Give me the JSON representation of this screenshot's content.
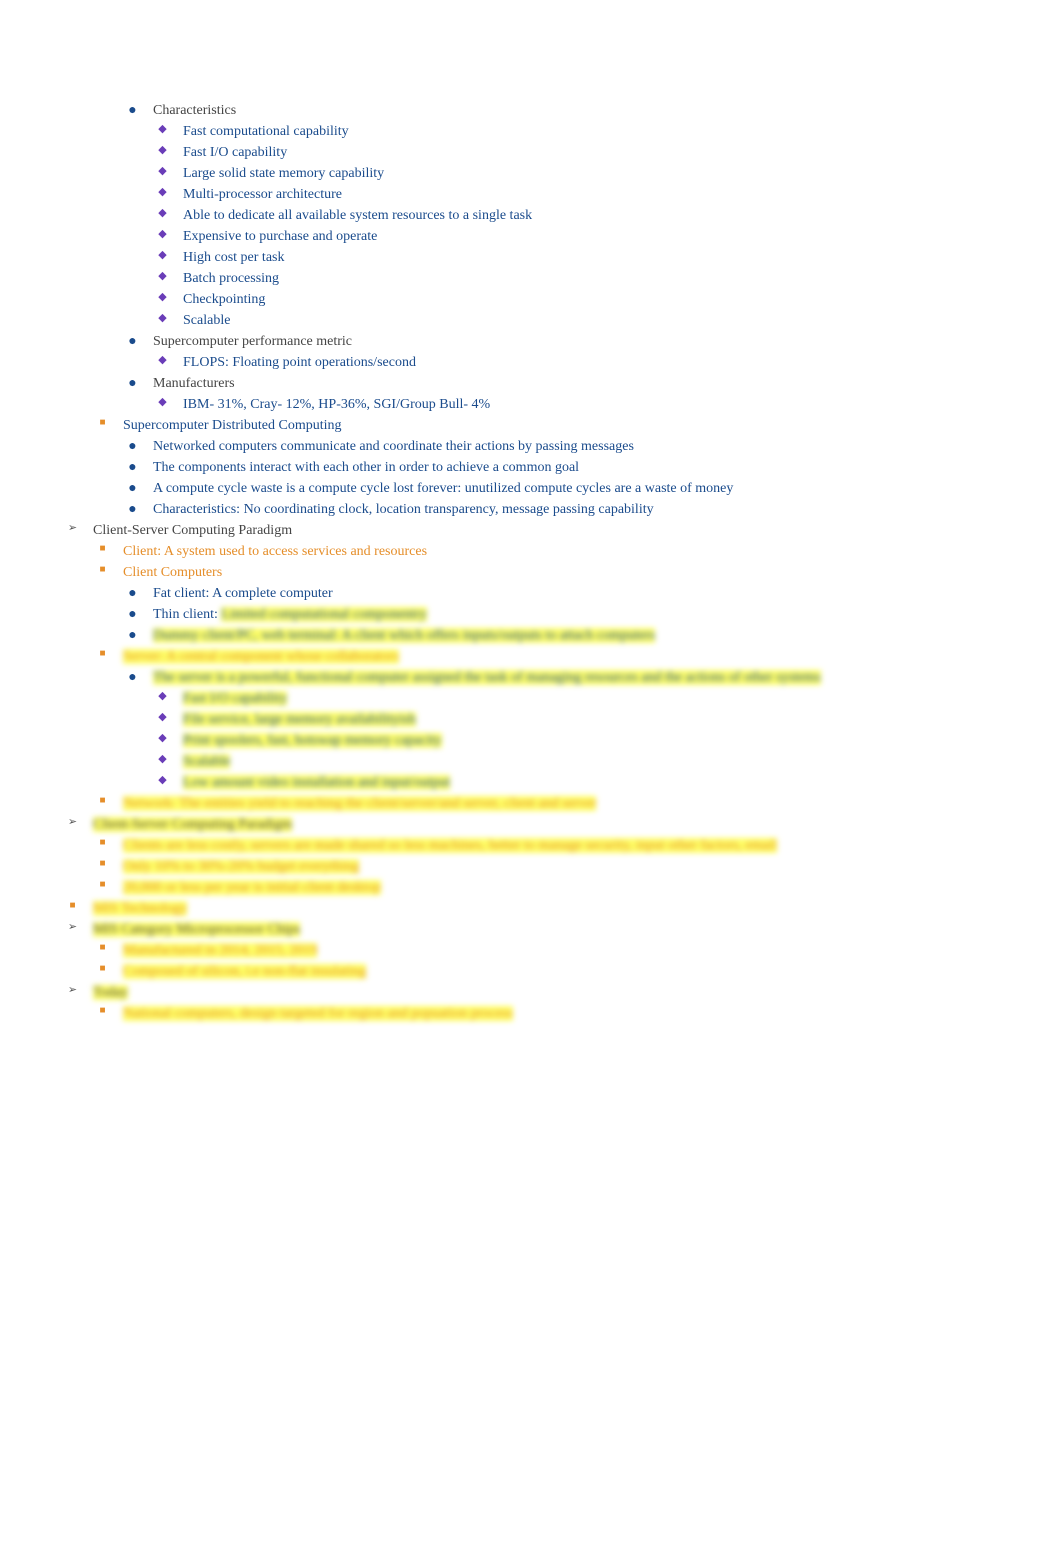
{
  "items": [
    {
      "level": "l2",
      "bstyle": "b-dot-blue",
      "bchar": "●",
      "tstyle": "c-dark",
      "text": "Characteristics"
    },
    {
      "level": "l3",
      "bstyle": "b-dia-purple",
      "bchar": "◆",
      "tstyle": "c-dblue",
      "text": "Fast computational capability"
    },
    {
      "level": "l3",
      "bstyle": "b-dia-purple",
      "bchar": "◆",
      "tstyle": "c-dblue",
      "text": "Fast I/O capability"
    },
    {
      "level": "l3",
      "bstyle": "b-dia-purple",
      "bchar": "◆",
      "tstyle": "c-dblue",
      "text": "Large solid state memory capability"
    },
    {
      "level": "l3",
      "bstyle": "b-dia-purple",
      "bchar": "◆",
      "tstyle": "c-dblue",
      "text": "Multi-processor architecture"
    },
    {
      "level": "l3",
      "bstyle": "b-dia-purple",
      "bchar": "◆",
      "tstyle": "c-dblue",
      "text": "Able to dedicate all available system resources to a single task"
    },
    {
      "level": "l3",
      "bstyle": "b-dia-purple",
      "bchar": "◆",
      "tstyle": "c-dblue",
      "text": "Expensive to purchase and operate"
    },
    {
      "level": "l3",
      "bstyle": "b-dia-purple",
      "bchar": "◆",
      "tstyle": "c-dblue",
      "text": "High cost per task"
    },
    {
      "level": "l3",
      "bstyle": "b-dia-purple",
      "bchar": "◆",
      "tstyle": "c-dblue",
      "text": "Batch processing"
    },
    {
      "level": "l3",
      "bstyle": "b-dia-purple",
      "bchar": "◆",
      "tstyle": "c-dblue",
      "text": "Checkpointing"
    },
    {
      "level": "l3",
      "bstyle": "b-dia-purple",
      "bchar": "◆",
      "tstyle": "c-dblue",
      "text": "Scalable"
    },
    {
      "level": "l2",
      "bstyle": "b-dot-blue",
      "bchar": "●",
      "tstyle": "c-dark",
      "text": "Supercomputer performance metric"
    },
    {
      "level": "l3",
      "bstyle": "b-dia-purple",
      "bchar": "◆",
      "tstyle": "c-dblue",
      "text": "FLOPS:   Floating point operations/second"
    },
    {
      "level": "l2",
      "bstyle": "b-dot-blue",
      "bchar": "●",
      "tstyle": "c-dark",
      "text": "Manufacturers"
    },
    {
      "level": "l3",
      "bstyle": "b-dia-purple",
      "bchar": "◆",
      "tstyle": "c-dblue",
      "text": "IBM- 31%, Cray- 12%, HP-36%, SGI/Group Bull- 4%"
    },
    {
      "level": "l1",
      "bstyle": "b-sq-orange",
      "bchar": "■",
      "tstyle": "c-blue",
      "text": "Supercomputer Distributed Computing"
    },
    {
      "level": "l2",
      "bstyle": "b-dot-blue",
      "bchar": "●",
      "tstyle": "c-dblue",
      "text": "Networked computers communicate and coordinate their actions by passing messages"
    },
    {
      "level": "l2",
      "bstyle": "b-dot-blue",
      "bchar": "●",
      "tstyle": "c-dblue",
      "text": "The components interact with each other in order to achieve a common goal"
    },
    {
      "level": "l2",
      "bstyle": "b-dot-blue",
      "bchar": "●",
      "tstyle": "c-dblue",
      "text": "A compute cycle waste is a compute cycle lost forever: unutilized compute cycles are a waste of money"
    },
    {
      "level": "l2",
      "bstyle": "b-dot-blue",
      "bchar": "●",
      "tstyle": "c-dblue",
      "text": "Characteristics:      No coordinating clock, location transparency, message passing capability"
    },
    {
      "level": "l0",
      "bstyle": "b-bird",
      "bchar": "➢",
      "tstyle": "c-dark",
      "text": "Client-Server Computing Paradigm"
    },
    {
      "level": "l1",
      "bstyle": "b-sq-orange",
      "bchar": "■",
      "tstyle": "c-orange",
      "text": "Client:   A system used to access services and resources"
    },
    {
      "level": "l1",
      "bstyle": "b-sq-orange",
      "bchar": "■",
      "tstyle": "c-orange",
      "text": "Client Computers"
    },
    {
      "level": "l2",
      "bstyle": "b-dot-blue",
      "bchar": "●",
      "tstyle": "c-dblue",
      "text": "Fat client:    A complete computer"
    },
    {
      "level": "l2",
      "bstyle": "b-dot-blue",
      "bchar": "●",
      "tstyle": "c-dblue",
      "text2": "Thin client:    ",
      "hl": true,
      "text": "Limited computational componentry"
    },
    {
      "level": "l2",
      "bstyle": "b-dot-blue",
      "bchar": "●",
      "tstyle": "c-dblue",
      "hl": true,
      "text": "Dummy client/PC, web terminal: A client which offers inputs/outputs to attach computers"
    },
    {
      "level": "l1",
      "bstyle": "b-sq-orange",
      "bchar": "■",
      "tstyle": "c-orange",
      "hl": true,
      "text": "Server:    A central component whose collaborators"
    },
    {
      "level": "l2",
      "bstyle": "b-dot-blue",
      "bchar": "●",
      "tstyle": "c-dblue",
      "hl": true,
      "text": "The server is a powerful, functional computer assigned the task of managing resources and the actions of other systems"
    },
    {
      "level": "l3",
      "bstyle": "b-dia-purple",
      "bchar": "◆",
      "tstyle": "c-dblue",
      "hl": true,
      "text": "Fast I/O capability"
    },
    {
      "level": "l3",
      "bstyle": "b-dia-purple",
      "bchar": "◆",
      "tstyle": "c-dblue",
      "hl": true,
      "text": "File service, large memory availabilityish"
    },
    {
      "level": "l3",
      "bstyle": "b-dia-purple",
      "bchar": "◆",
      "tstyle": "c-dblue",
      "hl": true,
      "text": "Print spoolers, fast, hotswap memory capacity"
    },
    {
      "level": "l3",
      "bstyle": "b-dia-purple",
      "bchar": "◆",
      "tstyle": "c-dblue",
      "hl": true,
      "text": "Scalable"
    },
    {
      "level": "l3",
      "bstyle": "b-dia-purple",
      "bchar": "◆",
      "tstyle": "c-dblue",
      "hl": true,
      "text": "Low amount video installation and input/output"
    },
    {
      "level": "l1",
      "bstyle": "b-sq-orange",
      "bchar": "■",
      "tstyle": "c-orange",
      "hl": true,
      "text": "Network:   The entities yield to reaching the client/server/and server, client and server"
    },
    {
      "level": "l0",
      "bstyle": "b-bird",
      "bchar": "➢",
      "tstyle": "c-dark",
      "hl": true,
      "text": "Client-Server Computing Paradigm"
    },
    {
      "level": "l1",
      "bstyle": "b-sq-orange",
      "bchar": "■",
      "tstyle": "c-orange",
      "hl": true,
      "text": "Clients are less costly, servers are made shared so less machines, better to manage security, input other factors, email"
    },
    {
      "level": "l1",
      "bstyle": "b-sq-orange",
      "bchar": "■",
      "tstyle": "c-orange",
      "hl": true,
      "text": "Only 10% to 30%-20% budget everything"
    },
    {
      "level": "l1",
      "bstyle": "b-sq-orange",
      "bchar": "■",
      "tstyle": "c-orange",
      "hl": true,
      "text": "20,000 or less per year is initial client desktop"
    },
    {
      "level": "l0",
      "bstyle": "b-sq-orange",
      "bchar": "■",
      "tstyle": "c-orange",
      "hl": true,
      "text": "MIS Technology"
    },
    {
      "level": "l0",
      "bstyle": "b-bird",
      "bchar": "➢",
      "tstyle": "c-dark",
      "hl": true,
      "text": "MIS Category Microprocessor Chips"
    },
    {
      "level": "l1",
      "bstyle": "b-sq-orange",
      "bchar": "■",
      "tstyle": "c-orange",
      "hl": true,
      "text": "Manufactured in 2014, 2015, 2019"
    },
    {
      "level": "l1",
      "bstyle": "b-sq-orange",
      "bchar": "■",
      "tstyle": "c-orange",
      "hl": true,
      "text": "Composed of silicon, i.e non-flat insulating"
    },
    {
      "level": "l0",
      "bstyle": "b-bird",
      "bchar": "➢",
      "tstyle": "c-dark",
      "hl": true,
      "text": "Today"
    },
    {
      "level": "l1",
      "bstyle": "b-sq-orange",
      "bchar": "■",
      "tstyle": "c-orange",
      "hl": true,
      "text": "National computers, design targeted for region and popuation process"
    }
  ]
}
